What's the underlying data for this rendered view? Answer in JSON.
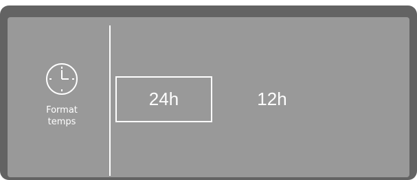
{
  "menu": {
    "icon": "clock-icon",
    "label_line1": "Format",
    "label_line2": "temps"
  },
  "options": [
    {
      "label": "24h",
      "selected": true
    },
    {
      "label": "12h",
      "selected": false
    }
  ],
  "colors": {
    "bezel": "#636363",
    "screen": "#999999",
    "foreground": "#ffffff"
  }
}
